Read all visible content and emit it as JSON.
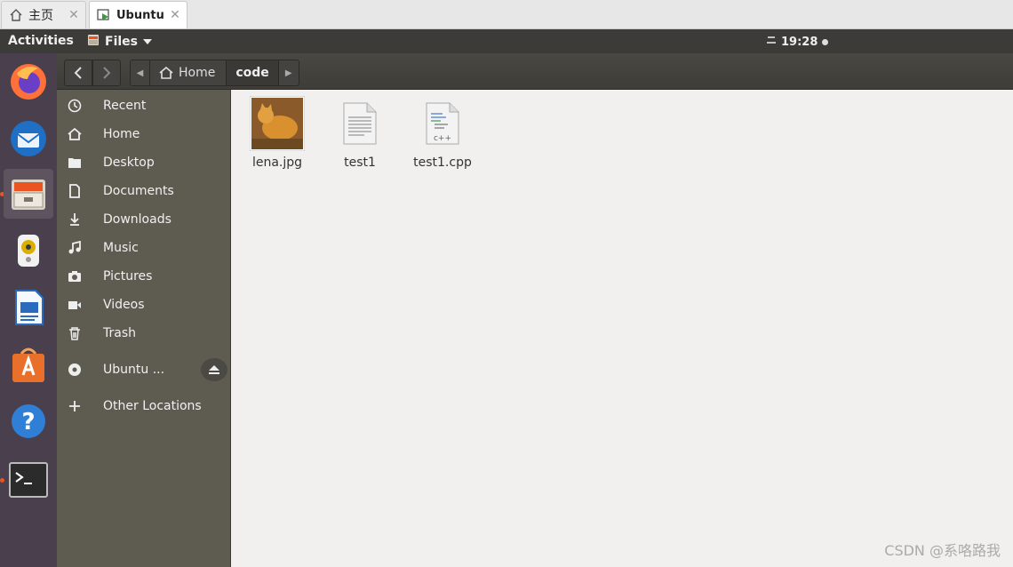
{
  "host_tabs": [
    {
      "label": "主页",
      "icon": "home-icon"
    },
    {
      "label": "Ubuntu",
      "icon": "vm-icon"
    }
  ],
  "topbar": {
    "activities": "Activities",
    "app_menu": "Files",
    "clock": "19:28"
  },
  "dock": {
    "items": [
      {
        "name": "firefox-icon"
      },
      {
        "name": "thunderbird-icon"
      },
      {
        "name": "files-icon"
      },
      {
        "name": "rhythmbox-icon"
      },
      {
        "name": "libreoffice-writer-icon"
      },
      {
        "name": "ubuntu-software-icon"
      },
      {
        "name": "help-icon"
      },
      {
        "name": "terminal-icon"
      }
    ]
  },
  "pathbar": {
    "home": "Home",
    "current": "code"
  },
  "sidebar": {
    "items": [
      {
        "label": "Recent",
        "icon": "recent-icon"
      },
      {
        "label": "Home",
        "icon": "home-icon"
      },
      {
        "label": "Desktop",
        "icon": "desktop-folder-icon"
      },
      {
        "label": "Documents",
        "icon": "document-icon"
      },
      {
        "label": "Downloads",
        "icon": "download-icon"
      },
      {
        "label": "Music",
        "icon": "music-icon"
      },
      {
        "label": "Pictures",
        "icon": "camera-icon"
      },
      {
        "label": "Videos",
        "icon": "video-icon"
      },
      {
        "label": "Trash",
        "icon": "trash-icon"
      },
      {
        "label": "Ubuntu ...",
        "icon": "disc-icon"
      },
      {
        "label": "Other Locations",
        "icon": "plus-icon"
      }
    ]
  },
  "files": [
    {
      "name": "lena.jpg",
      "icon": "image-thumbnail-icon"
    },
    {
      "name": "test1",
      "icon": "text-file-icon"
    },
    {
      "name": "test1.cpp",
      "icon": "cpp-file-icon"
    }
  ],
  "watermark": "CSDN @系咯路我",
  "colors": {
    "topbar": "#3c3b37",
    "dock": "#4a3f4c",
    "sidebar": "#5e5b51",
    "content": "#f1f0ee",
    "accent": "#e95420"
  }
}
